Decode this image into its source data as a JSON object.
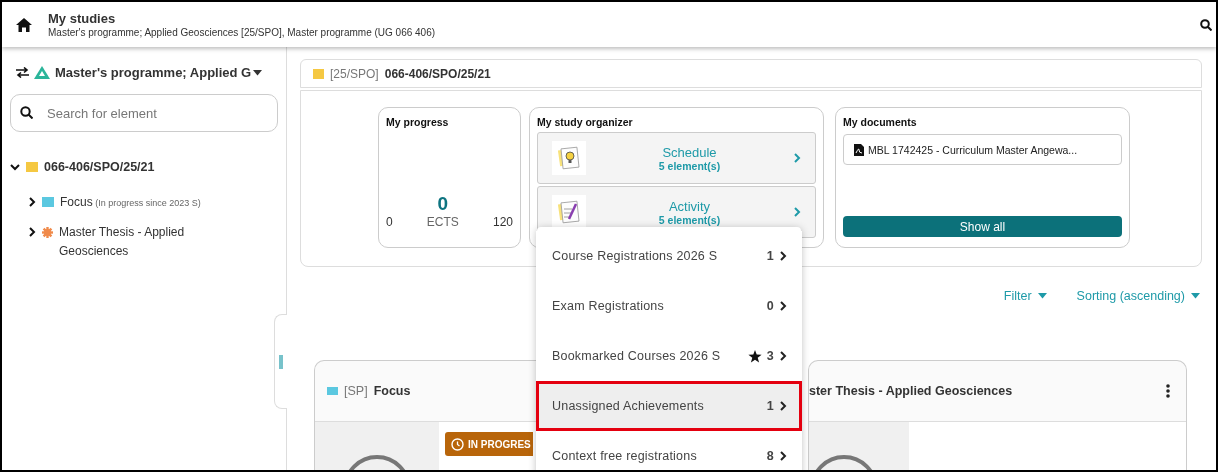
{
  "header": {
    "title": "My studies",
    "subtitle": "Master's programme; Applied Geosciences [25/SPO], Master programme (UG 066 406)"
  },
  "sidebar": {
    "programme": "Master's programme; Applied G",
    "search": {
      "placeholder": "Search for element"
    },
    "tree": [
      {
        "label": "066-406/SPO/25/21",
        "kind": "square",
        "color": "#f5c842",
        "expanded": true,
        "children": [
          {
            "label": "Focus",
            "note": "(In progress since 2023 S)",
            "kind": "square",
            "color": "#5bc8e0",
            "expanded": false
          },
          {
            "label": "Master Thesis - Applied Geosciences",
            "kind": "cog",
            "color": "#f08a4b",
            "expanded": false
          }
        ]
      }
    ]
  },
  "curriculum": {
    "tag": "[25/SPO]",
    "code": "066-406/SPO/25/21"
  },
  "progress": {
    "title": "My progress",
    "value": "0",
    "unit": "ECTS",
    "min": "0",
    "max": "120"
  },
  "organizer": {
    "title": "My study organizer",
    "items": [
      {
        "kind": "schedule",
        "label": "Schedule",
        "count": "5 element(s)"
      },
      {
        "kind": "activity",
        "label": "Activity",
        "count": "5 element(s)"
      }
    ]
  },
  "documents": {
    "title": "My documents",
    "items": [
      "MBL 1742425 - Curriculum Master Angewa..."
    ],
    "show_all": "Show all"
  },
  "toolbar": {
    "filter": "Filter",
    "sorting": "Sorting (ascending)"
  },
  "menu": [
    {
      "label": "Course Registrations 2026 S",
      "count": "1",
      "bookmarked": false,
      "selected": false
    },
    {
      "label": "Exam Registrations",
      "count": "0",
      "bookmarked": false,
      "selected": false
    },
    {
      "label": "Bookmarked Courses 2026 S",
      "count": "3",
      "bookmarked": true,
      "selected": false
    },
    {
      "label": "Unassigned Achievements",
      "count": "1",
      "bookmarked": false,
      "selected": true
    },
    {
      "label": "Context free registrations",
      "count": "8",
      "bookmarked": false,
      "selected": false
    }
  ],
  "cards": [
    {
      "tag": "[SP]",
      "title": "Focus",
      "color": "#5bc8e0",
      "badge": "IN PROGRES"
    },
    {
      "title": "ster Thesis - Applied Geosciences"
    }
  ]
}
